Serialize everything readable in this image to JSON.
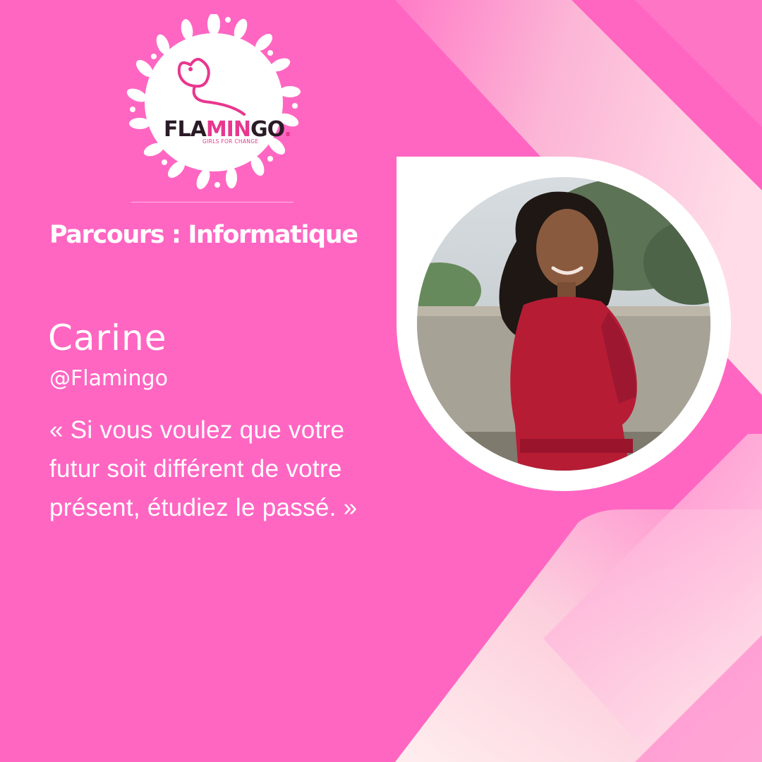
{
  "brand": {
    "name_part1": "FLA",
    "name_part2": "MIN",
    "name_part3": "GO",
    "name_dot": ".",
    "tagline": "GIRLS FOR CHANGE",
    "logo_icon": "flamingo-wreath-logo"
  },
  "profile": {
    "track": "Parcours : Informatique",
    "name": "Carine",
    "handle": "@Flamingo",
    "quote": "« Si vous voulez que votre futur soit différent de votre présent, étudiez le passé. »",
    "photo_icon": "portrait-photo"
  },
  "colors": {
    "background": "#ff66c2",
    "accent": "#e8378f",
    "text": "#ffffff",
    "ribbon_light": "#fde6e8"
  }
}
